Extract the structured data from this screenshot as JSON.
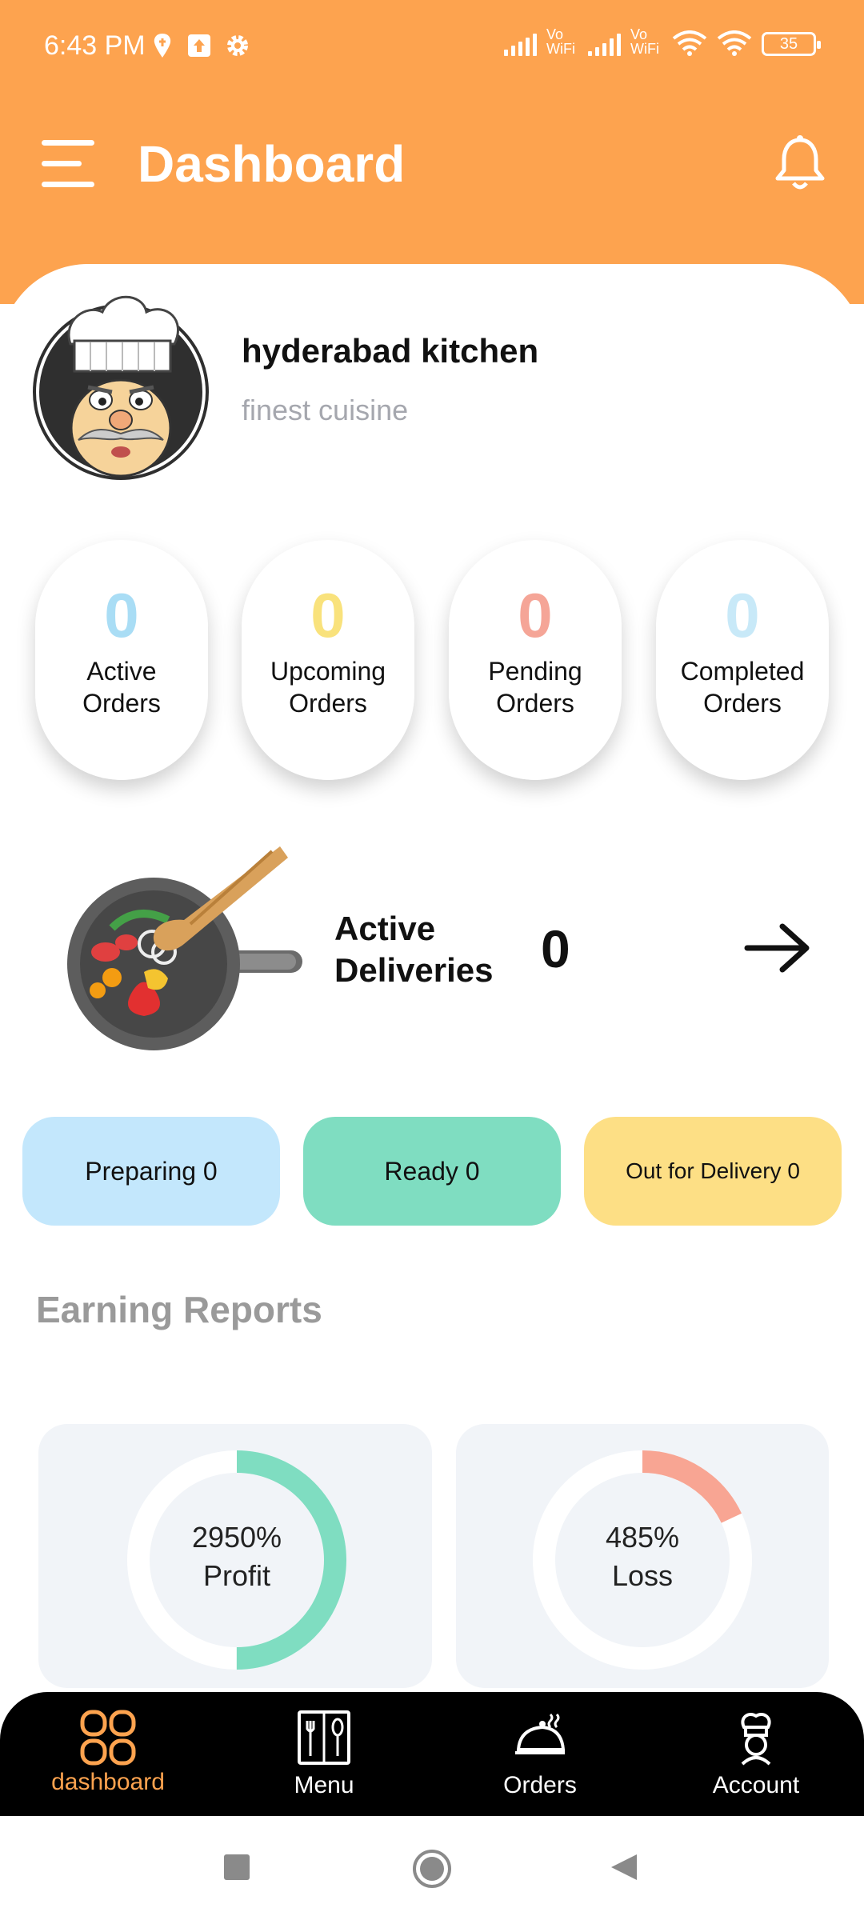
{
  "status_bar": {
    "time": "6:43 PM",
    "vowifi_1": "Vo WiFi",
    "vowifi_2": "Vo WiFi",
    "battery": "35"
  },
  "header": {
    "title": "Dashboard"
  },
  "profile": {
    "name": "hyderabad kitchen",
    "tagline": "finest cuisine"
  },
  "order_stats": [
    {
      "count": "0",
      "label_line1": "Active",
      "label_line2": "Orders",
      "color": "#A9DDF5"
    },
    {
      "count": "0",
      "label_line1": "Upcoming",
      "label_line2": "Orders",
      "color": "#F9E27C"
    },
    {
      "count": "0",
      "label_line1": "Pending",
      "label_line2": "Orders",
      "color": "#F5A597"
    },
    {
      "count": "0",
      "label_line1": "Completed",
      "label_line2": "Orders",
      "color": "#C8E9F8"
    }
  ],
  "active_deliveries": {
    "label_line1": "Active",
    "label_line2": "Deliveries",
    "count": "0"
  },
  "delivery_chips": [
    {
      "label": "Preparing 0",
      "color": "#C3E7FC"
    },
    {
      "label": "Ready 0",
      "color": "#7FDDC1"
    },
    {
      "label": "Out for Delivery 0",
      "color": "#FDDF85"
    }
  ],
  "earnings": {
    "title": "Earning Reports",
    "profit": {
      "value_label": "2950%",
      "kind": "Profit",
      "color": "#7FDDC1",
      "fill_fraction": 0.5
    },
    "loss": {
      "value_label": "485%",
      "kind": "Loss",
      "color": "#F8A593",
      "fill_fraction": 0.18
    }
  },
  "bottom_nav": {
    "items": [
      {
        "label": "dashboard",
        "icon": "dashboard-grid-icon",
        "active": true
      },
      {
        "label": "Menu",
        "icon": "menu-book-icon",
        "active": false
      },
      {
        "label": "Orders",
        "icon": "cloche-icon",
        "active": false
      },
      {
        "label": "Account",
        "icon": "chef-icon",
        "active": false
      }
    ],
    "active_color": "#FDA34F"
  }
}
